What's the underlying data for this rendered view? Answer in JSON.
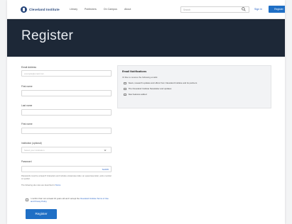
{
  "nav": {
    "logo_text": "Cleveland Institute",
    "links": [
      "Library",
      "Publishers",
      "On Campus",
      "About"
    ],
    "search_placeholder": "Search",
    "sign_in": "Sign in",
    "register": "Register"
  },
  "hero": {
    "title": "Register"
  },
  "form": {
    "email_label": "Email Address",
    "email_placeholder": "example@email.com",
    "first_name_label": "First name",
    "last_name_label": "Last name",
    "third_label": "First name",
    "institution_label": "Institution (optional)",
    "institution_placeholder": "Select your institution",
    "password_label": "Password",
    "password_show": "SHOW",
    "password_help": "Passwords must be at least 8 characters and include a lowercase letter, an uppercase letter, and a number or symbol.",
    "privacy_text": "The following site rules are described in",
    "privacy_link": "Terms",
    "consent_text": "I confirm that I am at least 16 years old and I accept the",
    "consent_link": "Cleveland Institute Terms of Use and Privacy Policy",
    "submit": "Register"
  },
  "notifications": {
    "title": "Email Notifications",
    "subtitle": "I'd like to receive the following emails:",
    "options": [
      "News, research updates and offers from Cleveland Institute and its partners",
      "The Cleveland Institute Newsletter and updates",
      "New features added"
    ]
  }
}
